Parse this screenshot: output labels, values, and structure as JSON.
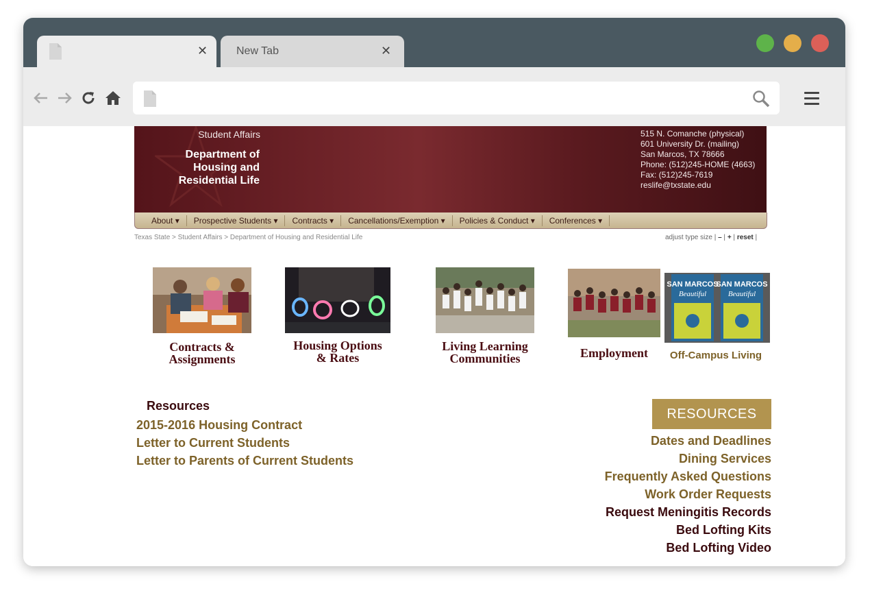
{
  "browser": {
    "tabs": [
      {
        "title": "",
        "active": true
      },
      {
        "title": "New Tab",
        "active": false
      }
    ],
    "url": "",
    "window_controls": [
      "green",
      "yellow",
      "red"
    ],
    "icons": [
      "back-arrow-icon",
      "forward-arrow-icon",
      "reload-icon",
      "home-icon",
      "search-icon",
      "menu-icon"
    ]
  },
  "site": {
    "header": {
      "student_affairs": "Student Affairs",
      "department": "Department of Housing and Residential Life",
      "address": [
        "515 N. Comanche (physical)",
        "601 University Dr. (mailing)",
        "San Marcos, TX 78666",
        "Phone: (512)245-HOME (4663)",
        "Fax: (512)245-7619",
        "reslife@txstate.edu"
      ]
    },
    "nav": [
      "About ▾",
      "Prospective Students ▾",
      "Contracts ▾",
      "Cancellations/Exemption ▾",
      "Policies & Conduct ▾",
      "Conferences ▾"
    ],
    "breadcrumb": "Texas State > Student Affairs > Department of Housing and Residential Life",
    "type_size": {
      "label": "adjust type size",
      "decrease": "–",
      "increase": "+",
      "reset": "reset"
    },
    "features": [
      {
        "label_line1": "Contracts &",
        "label_line2": "Assignments"
      },
      {
        "label_line1": "Housing Options",
        "label_line2": "& Rates"
      },
      {
        "label_line1": "Living Learning",
        "label_line2": "Communities"
      },
      {
        "label_line1": "Employment",
        "label_line2": ""
      },
      {
        "label_line1": "Off-Campus Living",
        "label_line2": "",
        "sign_text": "SAN MARCOS",
        "sign_sub": "Beautiful"
      }
    ],
    "resources_left": {
      "heading": "Resources",
      "links": [
        "2015-2016 Housing Contract",
        "Letter to Current Students",
        "Letter to Parents of Current Students"
      ]
    },
    "resources_right": {
      "badge": "RESOURCES",
      "links": [
        "Dates and Deadlines",
        "Dining Services",
        "Frequently Asked Questions",
        "Work Order Requests",
        "Request Meningitis Records",
        "Bed Lofting Kits",
        "Bed Lofting Video"
      ]
    },
    "colors": {
      "maroon": "#501214",
      "gold": "#7d6229",
      "badge_gold": "#b2944f"
    }
  }
}
